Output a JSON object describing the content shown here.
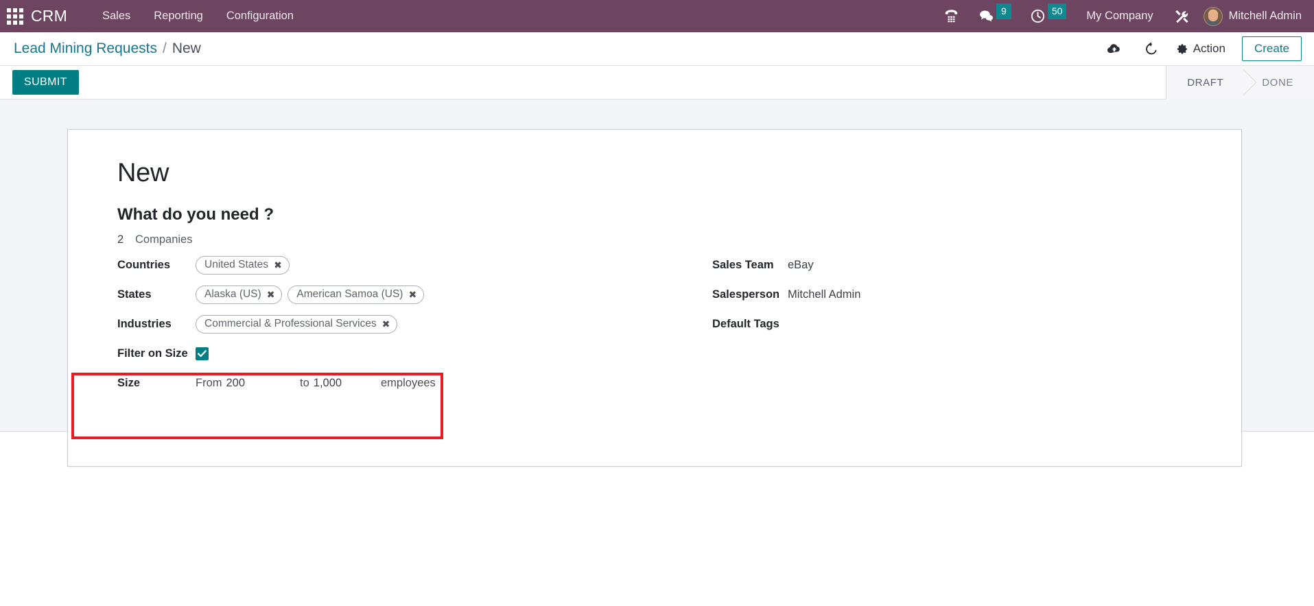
{
  "navbar": {
    "apps_icon": "apps-grid-icon",
    "brand": "CRM",
    "menus": [
      "Sales",
      "Reporting",
      "Configuration"
    ],
    "systray": [
      {
        "icon": "voip-phone-icon",
        "name": "voip-phone",
        "badge": null
      },
      {
        "icon": "messages-icon",
        "name": "messages",
        "badge": "9"
      },
      {
        "icon": "activities-clock-icon",
        "name": "activities",
        "badge": "50"
      }
    ],
    "company": "My Company",
    "debug_icon": "tools-wrench-icon",
    "user": "Mitchell Admin",
    "bg_color": "#6d4560",
    "badge_color": "#0d8a8f"
  },
  "control_panel": {
    "breadcrumb_root": "Lead Mining Requests",
    "breadcrumb_sep": "/",
    "breadcrumb_current": "New",
    "save_icon": "cloud-upload-icon",
    "discard_icon": "undo-rotate-icon",
    "action_icon": "gear-icon",
    "action_label": "Action",
    "create_label": "Create"
  },
  "statusbar": {
    "submit_label": "SUBMIT",
    "stages": [
      {
        "label": "DRAFT",
        "current": true
      },
      {
        "label": "DONE",
        "current": false
      }
    ]
  },
  "form": {
    "title": "New",
    "section_title": "What do you need ?",
    "count": {
      "value": "2",
      "label": "Companies"
    },
    "left_fields": [
      {
        "label": "Countries",
        "type": "tags",
        "tags": [
          "United States"
        ]
      },
      {
        "label": "States",
        "type": "tags",
        "tags": [
          "Alaska (US)",
          "American Samoa (US)"
        ]
      },
      {
        "label": "Industries",
        "type": "tags",
        "tags": [
          "Commercial & Professional Services"
        ]
      }
    ],
    "filter_on_size": {
      "label": "Filter on Size",
      "checked": true
    },
    "size": {
      "label": "Size",
      "from_prefix": "From",
      "from_value": "200",
      "to_prefix": "to",
      "to_value": "1,000",
      "unit": "employees"
    },
    "right_fields": [
      {
        "label": "Sales Team",
        "value": "eBay"
      },
      {
        "label": "Salesperson",
        "value": "Mitchell Admin"
      },
      {
        "label": "Default Tags",
        "value": ""
      }
    ]
  },
  "highlight": {
    "color": "#e81c24",
    "target": "filter-on-size-and-size-rows"
  }
}
